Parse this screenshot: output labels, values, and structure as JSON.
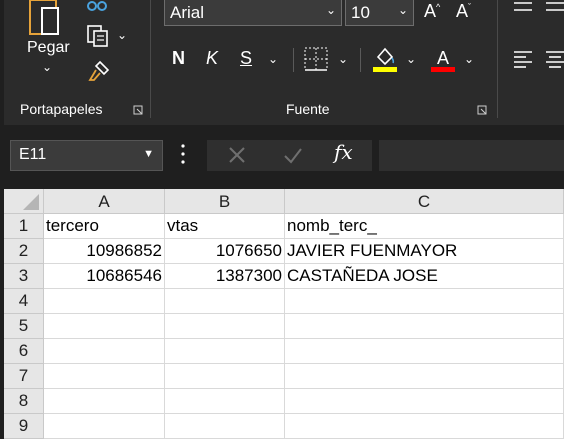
{
  "ribbon": {
    "clipboard": {
      "paste_label": "Pegar",
      "group_label": "Portapapeles",
      "icons": [
        "paste-icon",
        "cut-icon",
        "copy-icon",
        "format-painter-icon"
      ]
    },
    "font": {
      "group_label": "Fuente",
      "font_name": "Arial",
      "font_size": "10",
      "bold_label": "N",
      "italic_label": "K",
      "underline_label": "S",
      "grow_label": "A",
      "shrink_label": "A",
      "highlight_color": "#ffff00",
      "font_color": "#ff0000",
      "icons": [
        "borders-icon",
        "fill-color-icon",
        "font-color-icon"
      ]
    }
  },
  "formula_bar": {
    "name_box": "E11",
    "fx_label": "fx",
    "formula": ""
  },
  "grid": {
    "columns": [
      "A",
      "B",
      "C"
    ],
    "row_numbers": [
      "1",
      "2",
      "3",
      "4",
      "5",
      "6",
      "7",
      "8",
      "9"
    ],
    "rows": [
      [
        "tercero",
        "vtas",
        "nomb_terc_"
      ],
      [
        "10986852",
        "1076650",
        "JAVIER FUENMAYOR"
      ],
      [
        "10686546",
        "1387300",
        "CASTAÑEDA JOSE"
      ]
    ]
  }
}
